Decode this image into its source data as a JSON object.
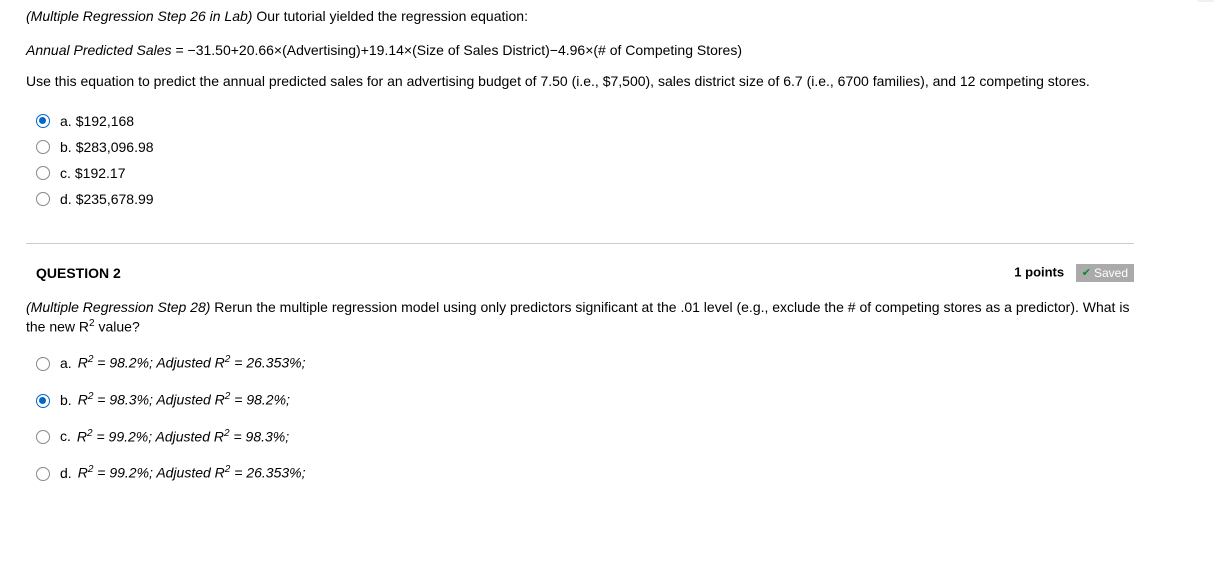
{
  "q1": {
    "ref": "(Multiple Regression Step 26 in Lab)",
    "intro": " Our tutorial yielded the regression equation:",
    "equation_lhs": "Annual Predicted Sales ",
    "equation_rhs": "−31.50+20.66×(Advertising)+19.14×(Size of Sales District)−4.96×(# of Competing Stores)",
    "instruction": "Use this equation to predict the annual predicted sales for an advertising budget of 7.50 (i.e., $7,500), sales district size of 6.7 (i.e., 6700 families), and 12 competing stores.",
    "options": [
      {
        "letter": "a.",
        "text": "$192,168",
        "selected": true
      },
      {
        "letter": "b.",
        "text": "$283,096.98",
        "selected": false
      },
      {
        "letter": "c.",
        "text": "$192.17",
        "selected": false
      },
      {
        "letter": "d.",
        "text": "$235,678.99",
        "selected": false
      }
    ]
  },
  "q2": {
    "heading": "QUESTION 2",
    "points": "1 points",
    "saved": "Saved",
    "ref": "(Multiple Regression Step 28)",
    "prompt": " Rerun the multiple regression model using only predictors significant at the .01 level (e.g., exclude the # of competing stores as a predictor). What is the new R",
    "prompt_tail": " value?",
    "options": [
      {
        "letter": "a.",
        "r2": "98.2%",
        "adj": "26.353%",
        "selected": false
      },
      {
        "letter": "b.",
        "r2": "98.3%",
        "adj": "98.2%",
        "selected": true
      },
      {
        "letter": "c.",
        "r2": "99.2%",
        "adj": "98.3%",
        "selected": false
      },
      {
        "letter": "d.",
        "r2": "99.2%",
        "adj": "26.353%",
        "selected": false
      }
    ]
  }
}
